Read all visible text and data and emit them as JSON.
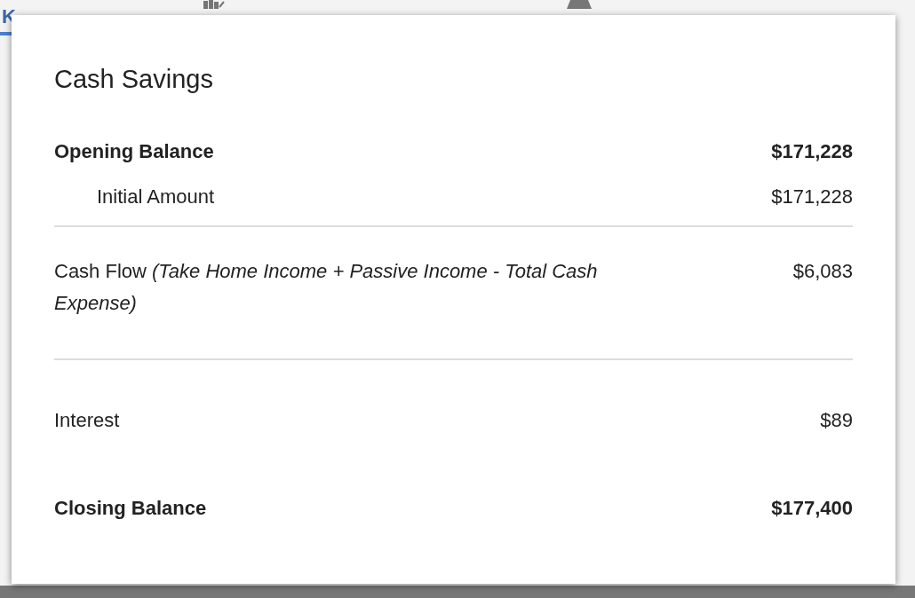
{
  "background": {
    "tab_letter": "K"
  },
  "dialog": {
    "title": "Cash Savings",
    "rows": [
      {
        "kind": "heading",
        "label": "Opening Balance",
        "amount": "$171,228"
      },
      {
        "kind": "sub",
        "label": "Initial Amount",
        "amount": "$171,228"
      },
      {
        "kind": "divider"
      },
      {
        "kind": "plain",
        "label": "Cash Flow *(Take Home Income + Passive Income - Total Cash Expense)*",
        "amount": "$6,083"
      },
      {
        "kind": "divider"
      },
      {
        "kind": "spaced",
        "label": "Interest",
        "amount": "$89"
      },
      {
        "kind": "total",
        "label": "Closing Balance",
        "amount": "$177,400"
      }
    ]
  }
}
